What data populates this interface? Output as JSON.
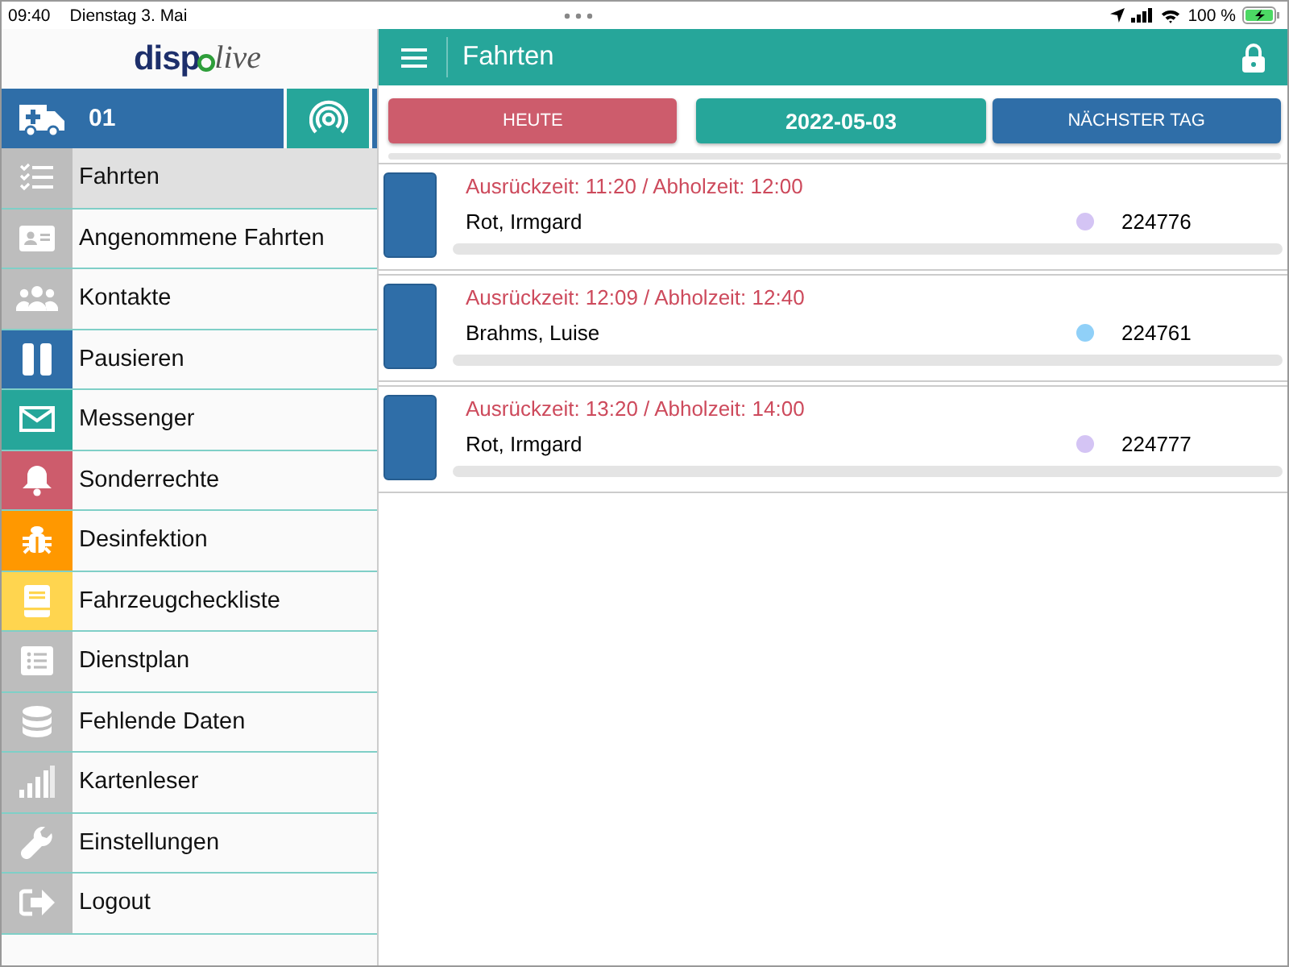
{
  "status_bar": {
    "time": "09:40",
    "date": "Dienstag 3. Mai",
    "battery": "100 %"
  },
  "logo": {
    "left": "disp",
    "right": "live"
  },
  "vehicle": {
    "number": "01"
  },
  "sidebar": {
    "items": [
      {
        "label": "Fahrten",
        "color": "#bdbdbd",
        "selected": true
      },
      {
        "label": "Angenommene Fahrten",
        "color": "#bdbdbd",
        "selected": false
      },
      {
        "label": "Kontakte",
        "color": "#bdbdbd",
        "selected": false
      },
      {
        "label": "Pausieren",
        "color": "#2f6ea8",
        "selected": false
      },
      {
        "label": "Messenger",
        "color": "#26a69a",
        "selected": false
      },
      {
        "label": "Sonderrechte",
        "color": "#cd5c6c",
        "selected": false
      },
      {
        "label": "Desinfektion",
        "color": "#ff9800",
        "selected": false
      },
      {
        "label": "Fahrzeugcheckliste",
        "color": "#ffd54f",
        "selected": false
      },
      {
        "label": "Dienstplan",
        "color": "#bdbdbd",
        "selected": false
      },
      {
        "label": "Fehlende Daten",
        "color": "#bdbdbd",
        "selected": false
      },
      {
        "label": "Kartenleser",
        "color": "#bdbdbd",
        "selected": false
      },
      {
        "label": "Einstellungen",
        "color": "#bdbdbd",
        "selected": false
      },
      {
        "label": "Logout",
        "color": "#bdbdbd",
        "selected": false
      }
    ]
  },
  "header": {
    "title": "Fahrten"
  },
  "day_buttons": [
    {
      "label": "HEUTE",
      "kind": "today"
    },
    {
      "label": "2022-05-03",
      "kind": "date"
    },
    {
      "label": "NÄCHSTER TAG",
      "kind": "next"
    }
  ],
  "trips": [
    {
      "times": "Ausrückzeit: 11:20 / Abholzeit: 12:00",
      "name": "Rot, Irmgard",
      "color": "#d4c4f4",
      "number": "224776"
    },
    {
      "times": "Ausrückzeit: 12:09 / Abholzeit: 12:40",
      "name": "Brahms, Luise",
      "color": "#90d0f8",
      "number": "224761"
    },
    {
      "times": "Ausrückzeit: 13:20 / Abholzeit: 14:00",
      "name": "Rot, Irmgard",
      "color": "#d4c4f4",
      "number": "224777"
    }
  ]
}
